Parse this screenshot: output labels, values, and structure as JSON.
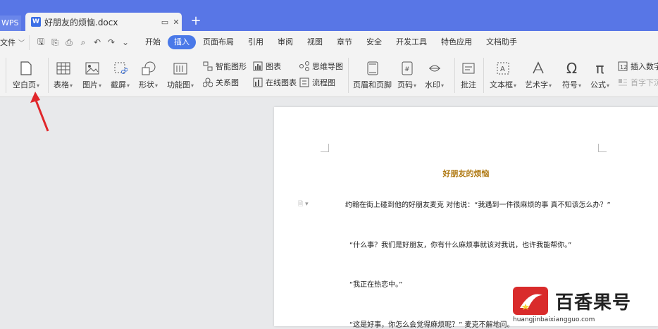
{
  "titlebar": {
    "app_tab": "WPS",
    "doc_tab": "好朋友的烦恼.docx",
    "doc_icon_letter": "W",
    "new_tab_symbol": "+"
  },
  "menubar": {
    "file_label": "文件",
    "items": [
      "开始",
      "插入",
      "页面布局",
      "引用",
      "审阅",
      "视图",
      "章节",
      "安全",
      "开发工具",
      "特色应用",
      "文档助手"
    ],
    "active_item": "插入"
  },
  "ribbon": {
    "blank_page": "空白页",
    "table": "表格",
    "picture": "图片",
    "screenshot": "截屏",
    "shape": "形状",
    "function_chart": "功能图",
    "smart_graphic": "智能图形",
    "chart": "图表",
    "mind_map": "思维导图",
    "relation_chart": "关系图",
    "online_chart": "在线图表",
    "flowchart": "流程图",
    "header_footer": "页眉和页脚",
    "page_number": "页码",
    "watermark": "水印",
    "comment": "批注",
    "text_box": "文本框",
    "art_text": "艺术字",
    "symbol": "符号",
    "formula": "公式",
    "insert_number": "插入数字",
    "first_char_sink": "首字下沉"
  },
  "document": {
    "title": "好朋友的烦恼",
    "paragraphs": [
      "约翰在街上碰到他的好朋友麦克 对他说：“我遇到一件很麻烦的事 真不知该怎么办？”",
      "“什么事？我们是好朋友，你有什么麻烦事就该对我说，也许我能帮你。”",
      "“我正在热恋中。”",
      "“这是好事，你怎么会觉得麻烦呢？” 麦克不解地问。"
    ]
  },
  "watermark_overlay": {
    "brand": "百香果号",
    "url": "huangjinbaixiangguo.com"
  },
  "colors": {
    "titlebar": "#5876e6",
    "active_tab": "#4a79e8",
    "doc_title": "#b07a14",
    "arrow": "#e0262a"
  }
}
